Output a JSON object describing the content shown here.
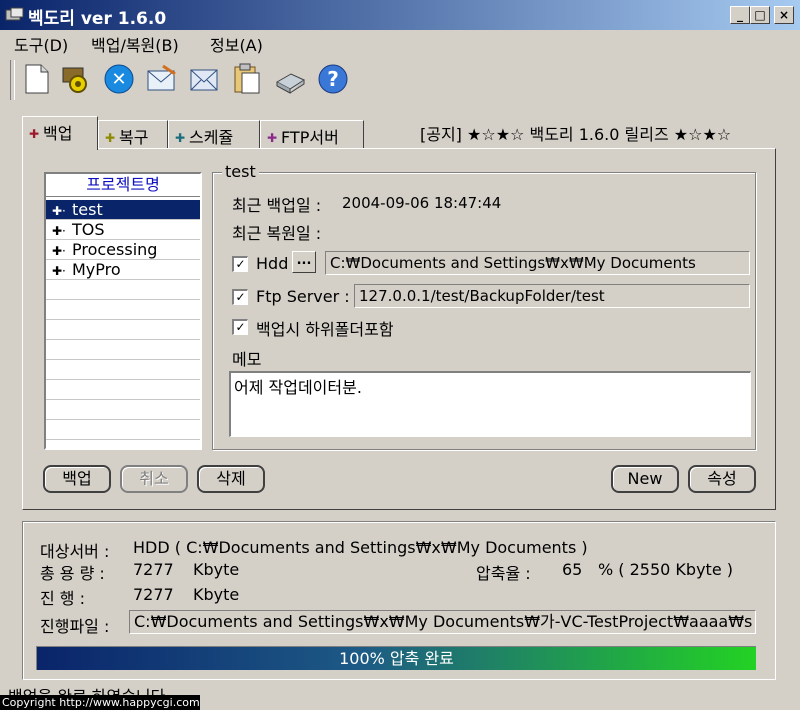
{
  "window": {
    "title": "벡도리 ver 1.6.0",
    "minimize": "_",
    "maximize": "□",
    "close": "×"
  },
  "menu": {
    "items": [
      "도구(D)",
      "백업/복원(B)",
      "정보(A)"
    ]
  },
  "toolbar": {
    "icons": [
      "new-document-icon",
      "settings-gear-icon",
      "stop-icon",
      "backup-envelope-icon",
      "restore-envelope-icon",
      "clipboard-icon",
      "scanner-icon",
      "help-icon"
    ],
    "help_glyph": "?",
    "stop_glyph": "✕"
  },
  "tabs": [
    {
      "label": "백업",
      "dot": "✚",
      "dot_color": "#9c1a2c"
    },
    {
      "label": "복구",
      "dot": "✚",
      "dot_color": "#8c8a00"
    },
    {
      "label": "스케쥴",
      "dot": "✚",
      "dot_color": "#1a6e7c"
    },
    {
      "label": "FTP서버",
      "dot": "✚",
      "dot_color": "#8c2a8c"
    }
  ],
  "notice": "[공지]  ★☆★☆ 백도리 1.6.0 릴리즈 ★☆★☆",
  "project_list": {
    "header": "프로젝트명",
    "items": [
      "test",
      "TOS",
      "Processing",
      "MyPro"
    ],
    "selected": "test"
  },
  "details": {
    "group_title": "test",
    "last_backup_label": "최근 백업일 :",
    "last_backup_value": "2004-09-06 18:47:44",
    "last_restore_label": "최근 복원일 :",
    "hdd_label": "Hdd",
    "browse_label": "...",
    "hdd_path": "C:₩Documents and Settings₩x₩My Documents",
    "ftp_label": "Ftp Server :",
    "ftp_path": "127.0.0.1/test/BackupFolder/test",
    "subfolder_label": "백업시 하위폴더포함",
    "memo_label": "메모",
    "memo_text": "어제 작업데이터분.",
    "checkmark": "✓"
  },
  "buttons": {
    "backup": "백업",
    "cancel": "취소",
    "delete": "삭제",
    "new": "New",
    "properties": "속성"
  },
  "status": {
    "target_label": "대상서버 :",
    "target_value": "HDD ( C:₩Documents and Settings₩x₩My Documents )",
    "total_label": "총 용 량 :",
    "total_value": "7277",
    "total_unit": "Kbyte",
    "compress_label": "압축율 :",
    "compress_value": "65",
    "compress_detail": "% ( 2550 Kbyte )",
    "progress_label": "진    행 :",
    "progress_value": "7277",
    "progress_unit": "Kbyte",
    "file_label": "진행파일 :",
    "file_path": "C:₩Documents and Settings₩x₩My Documents₩가-VC-TestProject₩aaaa₩s",
    "bar_text": "100% 압축 완료",
    "bar_fraction": 1.0
  },
  "statusbar": "백업을 완료 하였습니다",
  "copyright": "Copyright  http://www.happycgi.com"
}
